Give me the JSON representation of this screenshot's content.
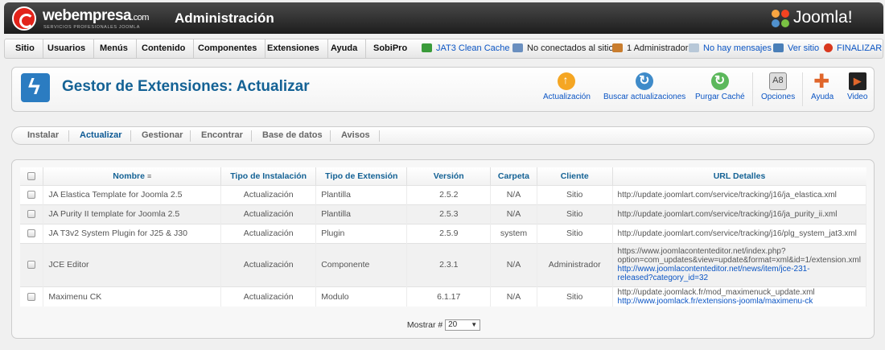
{
  "header": {
    "brand": "webempresa",
    "brand_suffix": ".com",
    "brand_tagline": "SERVICIOS PROFESIONALES JOOMLA",
    "title": "Administración",
    "cms_logo_text": "Joomla!"
  },
  "menu": {
    "items": [
      "Sitio",
      "Usuarios",
      "Menús",
      "Contenido",
      "Componentes",
      "Extensiones",
      "Ayuda",
      "SobiPro"
    ],
    "status": {
      "cache": "JAT3 Clean Cache",
      "connected": "No conectados al sitio",
      "admins": "1 Administrador",
      "messages": "No hay mensajes",
      "view_site": "Ver sitio",
      "logout": "FINALIZAR"
    }
  },
  "toolbar": {
    "page_title": "Gestor de Extensiones: Actualizar",
    "buttons": {
      "update": "Actualización",
      "find": "Buscar actualizaciones",
      "purge": "Purgar Caché",
      "options": "Opciones",
      "help": "Ayuda",
      "video": "Video"
    }
  },
  "subtabs": [
    "Instalar",
    "Actualizar",
    "Gestionar",
    "Encontrar",
    "Base de datos",
    "Avisos"
  ],
  "table": {
    "headers": {
      "name": "Nombre",
      "install_type": "Tipo de Instalación",
      "ext_type": "Tipo de Extensión",
      "version": "Versión",
      "folder": "Carpeta",
      "client": "Cliente",
      "url": "URL Detalles"
    },
    "rows": [
      {
        "name": "JA Elastica Template for Joomla 2.5",
        "install_type": "Actualización",
        "ext_type": "Plantilla",
        "version": "2.5.2",
        "folder": "N/A",
        "client": "Sitio",
        "url": "http://update.joomlart.com/service/tracking/j16/ja_elastica.xml"
      },
      {
        "name": "JA Purity II template for Joomla 2.5",
        "install_type": "Actualización",
        "ext_type": "Plantilla",
        "version": "2.5.3",
        "folder": "N/A",
        "client": "Sitio",
        "url": "http://update.joomlart.com/service/tracking/j16/ja_purity_ii.xml"
      },
      {
        "name": "JA T3v2 System Plugin for J25 & J30",
        "install_type": "Actualización",
        "ext_type": "Plugin",
        "version": "2.5.9",
        "folder": "system",
        "client": "Sitio",
        "url": "http://update.joomlart.com/service/tracking/j16/plg_system_jat3.xml"
      },
      {
        "name": "JCE Editor",
        "install_type": "Actualización",
        "ext_type": "Componente",
        "version": "2.3.1",
        "folder": "N/A",
        "client": "Administrador",
        "url_line1": "https://www.joomlacontenteditor.net/index.php?",
        "url_line2": "option=com_updates&view=update&format=xml&id=1/extension.xml",
        "link_line1": "http://www.joomlacontenteditor.net/news/item/jce-231-",
        "link_line2": "released?category_id=32"
      },
      {
        "name": "Maximenu CK",
        "install_type": "Actualización",
        "ext_type": "Modulo",
        "version": "6.1.17",
        "folder": "N/A",
        "client": "Sitio",
        "url": "http://update.joomlack.fr/mod_maximenuck_update.xml",
        "link": "http://www.joomlack.fr/extensions-joomla/maximenu-ck"
      }
    ]
  },
  "footer": {
    "show_label": "Mostrar #",
    "show_value": "20"
  }
}
